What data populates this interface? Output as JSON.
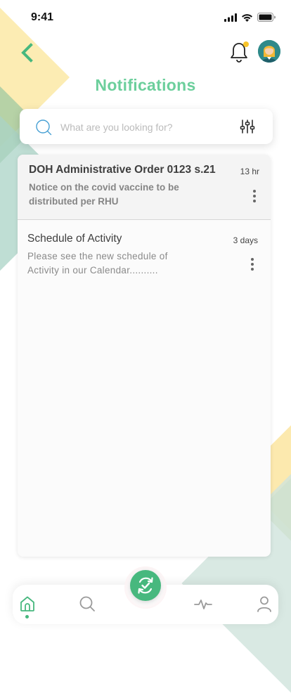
{
  "status_bar": {
    "time": "9:41"
  },
  "header": {
    "title": "Notifications"
  },
  "search": {
    "placeholder": "What are you looking for?"
  },
  "notifications": [
    {
      "title": "DOH Administrative Order 0123 s.21",
      "time": "13 hr",
      "body": "Notice on the covid vaccine to be distributed per RHU",
      "unread": true
    },
    {
      "title": "Schedule of Activity",
      "time": "3 days",
      "body": "Please see the new schedule of Activity in our Calendar..........",
      "unread": false
    }
  ],
  "icons": {
    "back": "chevron-left-icon",
    "bell": "bell-icon",
    "search": "search-icon",
    "filter": "sliders-icon",
    "more": "vertical-dots-icon",
    "nav": [
      "home-icon",
      "search-icon",
      "sync-check-icon",
      "activity-icon",
      "user-icon"
    ]
  },
  "colors": {
    "accent": "#47b87e",
    "title": "#6ccf9c",
    "notification_dot": "#f7c42b",
    "deco_yellow": "#fbe9a6",
    "deco_green": "#a9d3c5"
  },
  "bottom_nav": {
    "active": "home"
  }
}
